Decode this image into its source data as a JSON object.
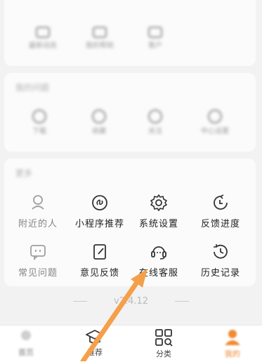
{
  "top_section": {
    "items": [
      {
        "label": "最新动态"
      },
      {
        "label": "我的帮助"
      },
      {
        "label": "客户"
      }
    ]
  },
  "help_section": {
    "title": "我的问题",
    "items": [
      {
        "label": "下载"
      },
      {
        "label": "收藏"
      },
      {
        "label": "关注"
      },
      {
        "label": "中心设置"
      }
    ]
  },
  "more_section": {
    "title": "更多",
    "items": [
      {
        "label": "附近的人",
        "icon": "person-location-icon"
      },
      {
        "label": "小程序推荐",
        "icon": "mini-program-icon"
      },
      {
        "label": "系统设置",
        "icon": "gear-icon"
      },
      {
        "label": "反馈进度",
        "icon": "clock-refresh-icon"
      },
      {
        "label": "常见问题",
        "icon": "chat-bubble-icon"
      },
      {
        "label": "意见反馈",
        "icon": "edit-note-icon"
      },
      {
        "label": "在线客服",
        "icon": "headset-icon"
      },
      {
        "label": "历史记录",
        "icon": "history-icon"
      }
    ]
  },
  "version": "v2.4.12",
  "tabbar": {
    "tabs": [
      {
        "label": "首页",
        "icon": "home-icon"
      },
      {
        "label": "推荐",
        "icon": "graduation-cap-icon"
      },
      {
        "label": "分类",
        "icon": "grid-search-icon"
      },
      {
        "label": "我的",
        "icon": "user-icon",
        "active": true
      }
    ]
  },
  "colors": {
    "accent": "#f08a33",
    "arrow": "#f4a04a"
  }
}
